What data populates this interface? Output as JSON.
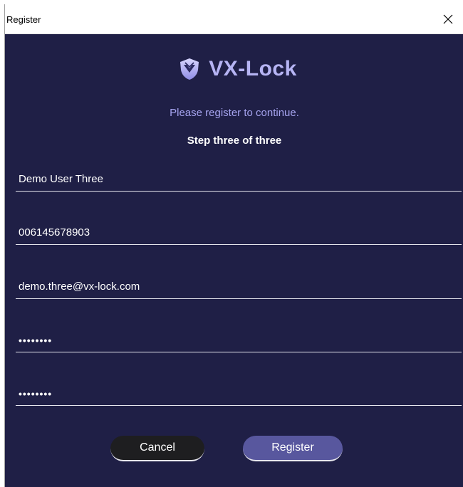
{
  "window": {
    "title": "Register"
  },
  "header": {
    "logo_text": "VX-Lock",
    "subtitle": "Please register to continue.",
    "step": "Step three of three"
  },
  "form": {
    "name": "Demo User Three",
    "phone": "006145678903",
    "email": "demo.three@vx-lock.com",
    "password": "••••••••",
    "confirm_password": "••••••••"
  },
  "buttons": {
    "cancel": "Cancel",
    "register": "Register"
  },
  "colors": {
    "background": "#1f1f46",
    "accent": "#b6b4f4",
    "subtitle": "#a5a3ee",
    "register_button": "#58579e",
    "cancel_button": "#1e1e20"
  },
  "icons": {
    "logo": "shield-icon",
    "close": "close-icon"
  }
}
